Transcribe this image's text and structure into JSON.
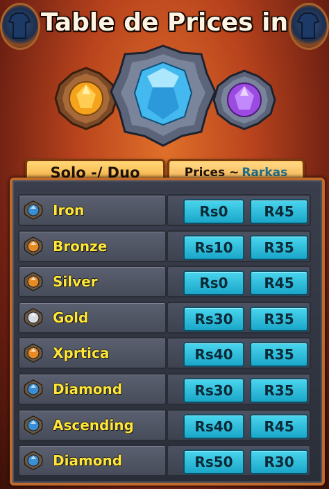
{
  "title": "Table de Prices in",
  "header": {
    "left_label": "Solo -/ Duo",
    "right_label_a": "Prices ~",
    "right_label_b": "Rarkas"
  },
  "gems_top": [
    {
      "color": "#f5a21c",
      "name": "amber-gem-icon"
    },
    {
      "color": "#43b9ef",
      "name": "blue-gem-icon"
    },
    {
      "color": "#9b4be0",
      "name": "purple-gem-icon"
    }
  ],
  "rows": [
    {
      "label": "Iron",
      "gem": "#3a8ed6",
      "price1": "Rs0",
      "price2": "R45"
    },
    {
      "label": "Bronze",
      "gem": "#e88a22",
      "price1": "Rs10",
      "price2": "R35"
    },
    {
      "label": "Silver",
      "gem": "#e88a22",
      "price1": "Rs0",
      "price2": "R45"
    },
    {
      "label": "Gold",
      "gem": "#d7dbe2",
      "price1": "Rs30",
      "price2": "R35"
    },
    {
      "label": "Xprtica",
      "gem": "#e88a22",
      "price1": "Rs40",
      "price2": "R35"
    },
    {
      "label": "Diamond",
      "gem": "#3a8ed6",
      "price1": "Rs30",
      "price2": "R35"
    },
    {
      "label": "Ascending",
      "gem": "#3a8ed6",
      "price1": "Rs40",
      "price2": "R45"
    },
    {
      "label": "Diamond",
      "gem": "#3a8ed6",
      "price1": "Rs50",
      "price2": "R30"
    }
  ],
  "colors": {
    "label_yellow": "#ffe63a",
    "price_cyan": "#2fc0e0",
    "frame_orange": "#c26a2a"
  }
}
